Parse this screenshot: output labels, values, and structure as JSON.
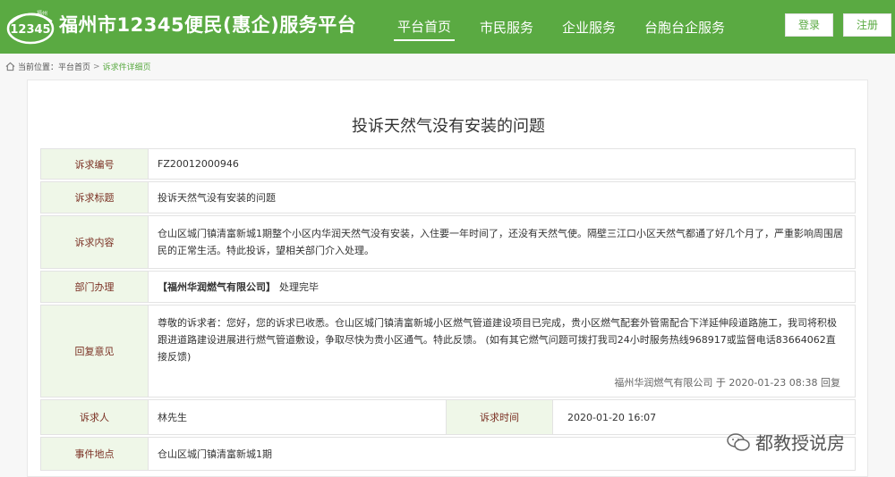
{
  "header": {
    "logo_text": "12345",
    "logo_small": "福州",
    "site_title": "福州市12345便民(惠企)服务平台",
    "nav": [
      {
        "label": "平台首页",
        "active": true
      },
      {
        "label": "市民服务",
        "active": false
      },
      {
        "label": "企业服务",
        "active": false
      },
      {
        "label": "台胞台企服务",
        "active": false
      }
    ],
    "login_label": "登录",
    "register_label": "注册",
    "brand_color": "#5aaa42"
  },
  "breadcrumb": {
    "prefix": "当前位置：",
    "home": "平台首页",
    "separator": ">",
    "current": "诉求件详细页"
  },
  "detail": {
    "title": "投诉天然气没有安装的问题",
    "fields": {
      "number_label": "诉求编号",
      "number_value": "FZ20012000946",
      "subject_label": "诉求标题",
      "subject_value": "投诉天然气没有安装的问题",
      "content_label": "诉求内容",
      "content_value": "仓山区城门镇清富新城1期整个小区内华润天然气没有安装，入住要一年时间了，还没有天然气使。隔壁三江口小区天然气都通了好几个月了，严重影响周围居民的正常生活。特此投诉，望相关部门介入处理。",
      "dept_label": "部门办理",
      "dept_name": "【福州华润燃气有限公司】",
      "dept_status": "处理完毕",
      "reply_label": "回复意见",
      "reply_value": "尊敬的诉求者：您好，您的诉求已收悉。仓山区城门镇清富新城小区燃气管道建设项目已完成，贵小区燃气配套外管需配合下洋延伸段道路施工，我司将积极跟进道路建设进展进行燃气管道敷设，争取尽快为贵小区通气。特此反馈。 (如有其它燃气问题可拨打我司24小时服务热线968917或监督电话83664062直接反馈)",
      "reply_meta": "福州华润燃气有限公司 于 2020-01-23 08:38 回复",
      "requester_label": "诉求人",
      "requester_value": "林先生",
      "time_label": "诉求时间",
      "time_value": "2020-01-20 16:07",
      "location_label": "事件地点",
      "location_value": "仓山区城门镇清富新城1期"
    }
  },
  "watermark": {
    "text": "都教授说房"
  }
}
